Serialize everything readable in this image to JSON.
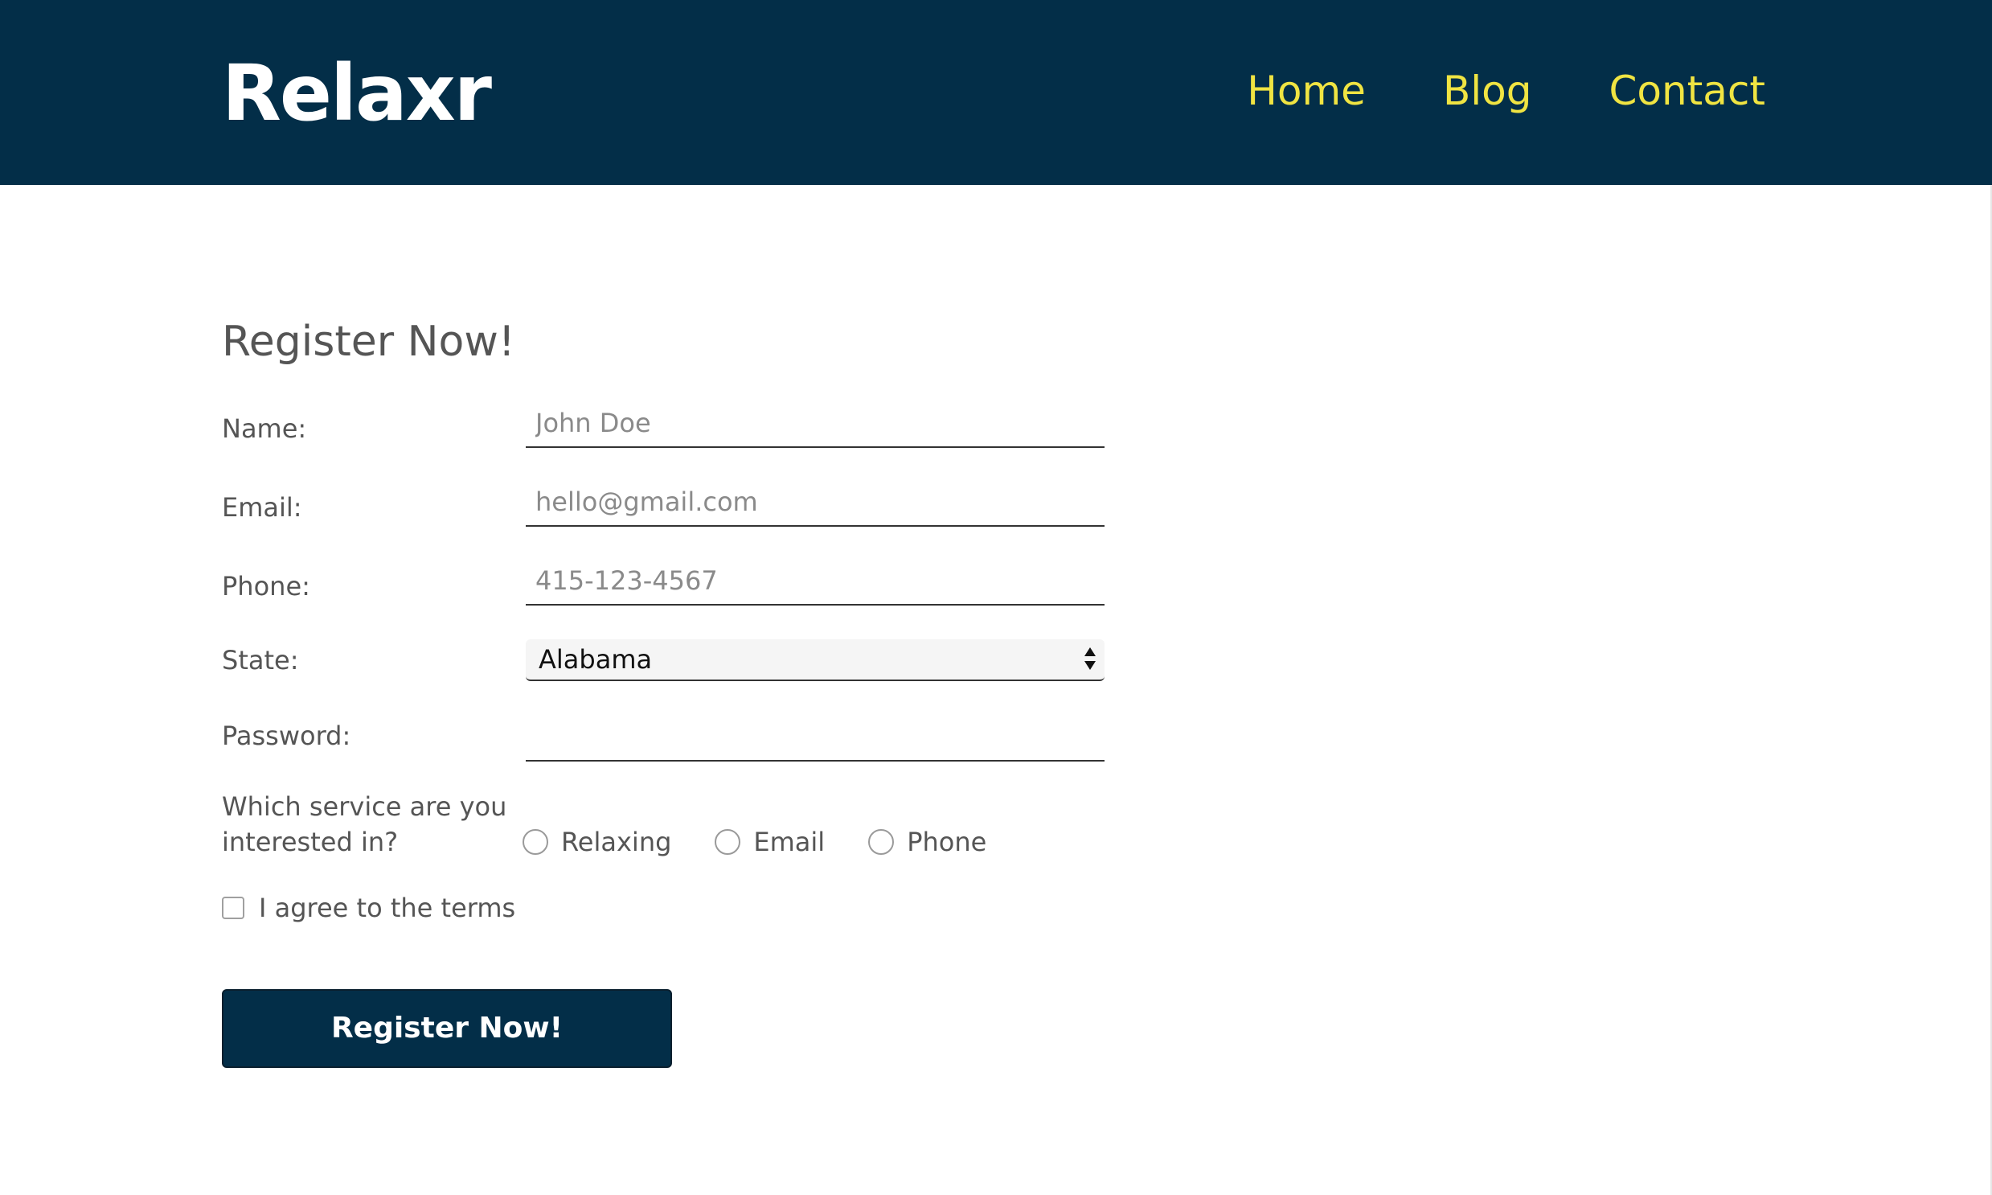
{
  "header": {
    "logo": "Relaxr",
    "nav": [
      {
        "label": "Home"
      },
      {
        "label": "Blog"
      },
      {
        "label": "Contact"
      }
    ],
    "background_color": "#032e48",
    "nav_color": "#f0e442"
  },
  "form": {
    "title": "Register Now!",
    "name": {
      "label": "Name:",
      "placeholder": "John Doe"
    },
    "email": {
      "label": "Email:",
      "placeholder": "hello@gmail.com"
    },
    "phone": {
      "label": "Phone:",
      "placeholder": "415-123-4567"
    },
    "state": {
      "label": "State:",
      "selected": "Alabama"
    },
    "password": {
      "label": "Password:",
      "placeholder": ""
    },
    "service": {
      "label_line1": "Which service are you",
      "label_line2": "interested in?",
      "options": [
        {
          "label": "Relaxing"
        },
        {
          "label": "Email"
        },
        {
          "label": "Phone"
        }
      ]
    },
    "terms": {
      "label": "I agree to the terms"
    },
    "submit_label": "Register Now!"
  }
}
